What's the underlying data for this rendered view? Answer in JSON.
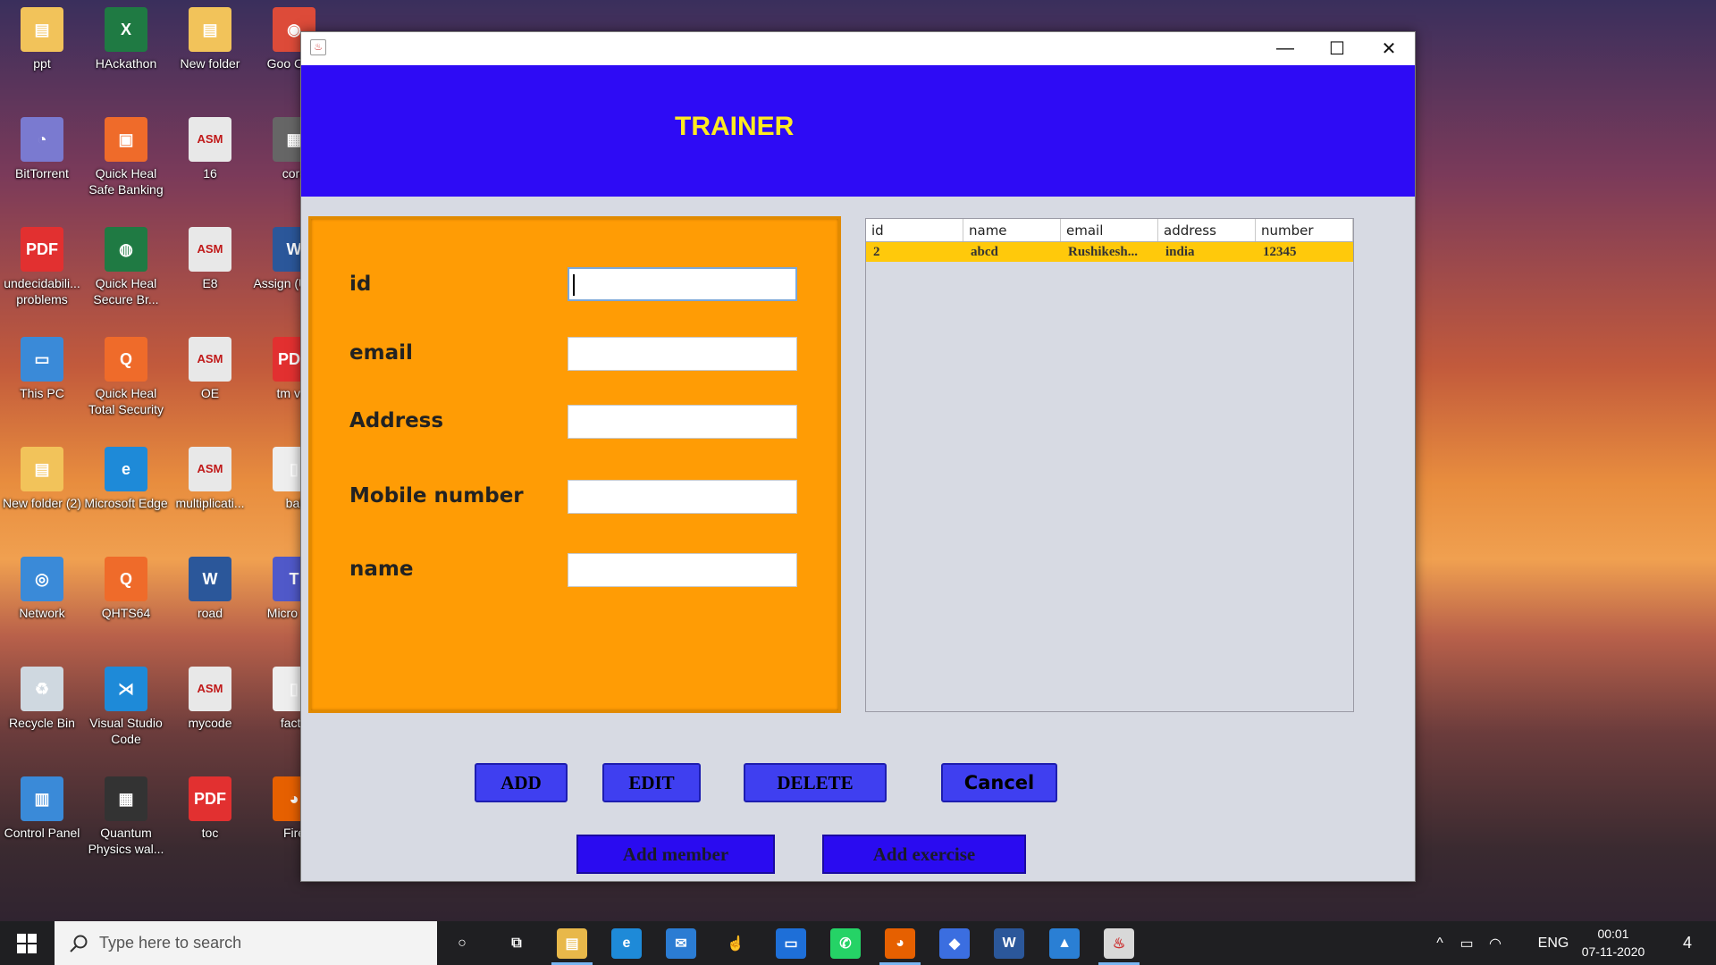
{
  "desktop_icons": [
    {
      "id": "ppt",
      "label": "ppt",
      "color": "#f2c35a",
      "glyph": "▤"
    },
    {
      "id": "hackathon",
      "label": "HAckathon",
      "color": "#1f7a43",
      "glyph": "X"
    },
    {
      "id": "new-folder",
      "label": "New folder",
      "color": "#f2c35a",
      "glyph": "▤"
    },
    {
      "id": "google-chrome",
      "label": "Goo Chro",
      "color": "#dd4b39",
      "glyph": "◉"
    },
    {
      "id": "bittorrent",
      "label": "BitTorrent",
      "color": "#7a7ad0",
      "glyph": "◔"
    },
    {
      "id": "quick-heal-safe-banking",
      "label": "Quick Heal Safe Banking",
      "color": "#ef6b2a",
      "glyph": "▣"
    },
    {
      "id": "asm-16",
      "label": "16",
      "color": "#e8e8e8",
      "glyph": "ASM"
    },
    {
      "id": "corc",
      "label": "corc",
      "color": "#666",
      "glyph": "▦"
    },
    {
      "id": "undecidability-problems",
      "label": "undecidabili... problems",
      "color": "#e23030",
      "glyph": "PDF"
    },
    {
      "id": "quick-heal-secure-browser",
      "label": "Quick Heal Secure Br...",
      "color": "#1f7a43",
      "glyph": "◍"
    },
    {
      "id": "asm-e8",
      "label": "E8",
      "color": "#e8e8e8",
      "glyph": "ASM"
    },
    {
      "id": "assignment",
      "label": "Assign (Undec",
      "color": "#2b579a",
      "glyph": "W"
    },
    {
      "id": "this-pc",
      "label": "This PC",
      "color": "#3a8ad8",
      "glyph": "▭"
    },
    {
      "id": "quick-heal-total-security",
      "label": "Quick Heal Total Security",
      "color": "#ef6b2a",
      "glyph": "Q"
    },
    {
      "id": "asm-oe",
      "label": "OE",
      "color": "#e8e8e8",
      "glyph": "ASM"
    },
    {
      "id": "tm-var",
      "label": "tm var",
      "color": "#e23030",
      "glyph": "PDF"
    },
    {
      "id": "new-folder-2",
      "label": "New folder (2)",
      "color": "#f2c35a",
      "glyph": "▤"
    },
    {
      "id": "microsoft-edge",
      "label": "Microsoft Edge",
      "color": "#1e8ad8",
      "glyph": "e"
    },
    {
      "id": "asm-multiplication",
      "label": "multiplicati...",
      "color": "#e8e8e8",
      "glyph": "ASM"
    },
    {
      "id": "bal",
      "label": "bal",
      "color": "#eee",
      "glyph": "▯"
    },
    {
      "id": "network",
      "label": "Network",
      "color": "#3a8ad8",
      "glyph": "◎"
    },
    {
      "id": "qhts64",
      "label": "QHTS64",
      "color": "#ef6b2a",
      "glyph": "Q"
    },
    {
      "id": "road",
      "label": "road",
      "color": "#2b579a",
      "glyph": "W"
    },
    {
      "id": "microsoft-teams",
      "label": "Micro Tea",
      "color": "#5059c9",
      "glyph": "T"
    },
    {
      "id": "recycle-bin",
      "label": "Recycle Bin",
      "color": "#cfd8e0",
      "glyph": "♻"
    },
    {
      "id": "visual-studio-code",
      "label": "Visual Studio Code",
      "color": "#1e8ad8",
      "glyph": "⋊"
    },
    {
      "id": "asm-mycode",
      "label": "mycode",
      "color": "#e8e8e8",
      "glyph": "ASM"
    },
    {
      "id": "facto",
      "label": "facto",
      "color": "#eee",
      "glyph": "▯"
    },
    {
      "id": "control-panel",
      "label": "Control Panel",
      "color": "#3a8ad8",
      "glyph": "▥"
    },
    {
      "id": "quantum-physics",
      "label": "Quantum Physics wal...",
      "color": "#333",
      "glyph": "▦"
    },
    {
      "id": "toc",
      "label": "toc",
      "color": "#e23030",
      "glyph": "PDF"
    },
    {
      "id": "firefox",
      "label": "Fire",
      "color": "#e66000",
      "glyph": "◕"
    }
  ],
  "window": {
    "controls": {
      "minimize": "—",
      "maximize": "☐",
      "close": "✕"
    },
    "java_icon": "♨"
  },
  "header": {
    "title": "TRAINER",
    "bg_color": "#2e0bf5",
    "title_color": "#ffea21"
  },
  "form": {
    "bg_color": "#ff9c05",
    "fields": [
      {
        "key": "id",
        "label": "id",
        "value": ""
      },
      {
        "key": "email",
        "label": "email",
        "value": ""
      },
      {
        "key": "address",
        "label": "Address",
        "value": ""
      },
      {
        "key": "mobile",
        "label": "Mobile number",
        "value": ""
      },
      {
        "key": "name",
        "label": "name",
        "value": ""
      }
    ]
  },
  "table": {
    "columns": [
      "id",
      "name",
      "email",
      "address",
      "number"
    ],
    "rows": [
      [
        "2",
        "abcd",
        "Rushikesh...",
        "india",
        "12345"
      ]
    ],
    "selected_row_color": "#ffc90b"
  },
  "actions": {
    "add": "ADD",
    "edit": "EDIT",
    "delete": "DELETE",
    "cancel": "Cancel",
    "add_member": "Add member",
    "add_exercise": "Add exercise"
  },
  "taskbar": {
    "search_placeholder": "Type here to search",
    "apps": [
      {
        "id": "cortana",
        "glyph": "○",
        "color": "transparent"
      },
      {
        "id": "task-view",
        "glyph": "⧉",
        "color": "transparent"
      },
      {
        "id": "file-explorer",
        "glyph": "▤",
        "color": "#e8b84a"
      },
      {
        "id": "edge",
        "glyph": "e",
        "color": "#1e8ad8"
      },
      {
        "id": "mail",
        "glyph": "✉",
        "color": "#2b7cd3"
      },
      {
        "id": "touch",
        "glyph": "☝",
        "color": "transparent"
      },
      {
        "id": "window-app",
        "glyph": "▭",
        "color": "#1e6fd8"
      },
      {
        "id": "whatsapp",
        "glyph": "✆",
        "color": "#25d366"
      },
      {
        "id": "firefox",
        "glyph": "◕",
        "color": "#e66000"
      },
      {
        "id": "box-app",
        "glyph": "◆",
        "color": "#3b6ee0"
      },
      {
        "id": "word",
        "glyph": "W",
        "color": "#2b579a"
      },
      {
        "id": "photos",
        "glyph": "▲",
        "color": "#2a7fd4"
      },
      {
        "id": "java",
        "glyph": "♨",
        "color": "#d8d8d8"
      }
    ],
    "tray": {
      "language": "ENG",
      "time": "00:01",
      "date": "07-11-2020",
      "notifications": "4",
      "chevron": "^",
      "battery": "▭",
      "network": "◠"
    }
  }
}
